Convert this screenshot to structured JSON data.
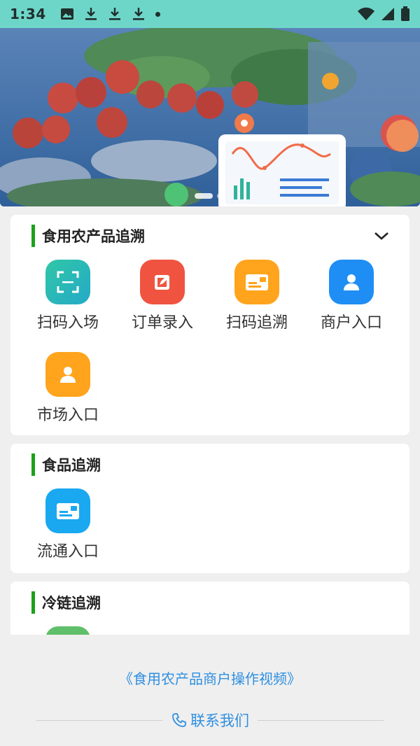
{
  "status_bar": {
    "time": "1:34",
    "notification_icons": [
      "image-icon",
      "download-icon",
      "download-icon",
      "download-icon",
      "dot-icon"
    ],
    "right_icons": [
      "wifi-icon",
      "signal-icon",
      "battery-icon"
    ]
  },
  "banner": {
    "slide_count": 2,
    "active_slide": 1
  },
  "sections": [
    {
      "title": "食用农产品追溯",
      "collapse_icon": "chevron-down-icon",
      "items": [
        {
          "label": "扫码入场",
          "icon": "scan-icon",
          "color": "#2bbfb0"
        },
        {
          "label": "订单录入",
          "icon": "edit-icon",
          "color": "#f05340"
        },
        {
          "label": "扫码追溯",
          "icon": "card-icon",
          "color": "#ffa41c"
        },
        {
          "label": "商户入口",
          "icon": "user-icon",
          "color": "#1e8ef5"
        },
        {
          "label": "市场入口",
          "icon": "user-icon",
          "color": "#ffa41c"
        }
      ]
    },
    {
      "title": "食品追溯",
      "items": [
        {
          "label": "流通入口",
          "icon": "card-icon",
          "color": "#1aa8f0"
        }
      ]
    },
    {
      "title": "冷链追溯",
      "items": []
    }
  ],
  "footer": {
    "video_link": "《食用农产品商户操作视频》",
    "contact_label": "联系我们",
    "contact_icon": "phone-icon"
  }
}
